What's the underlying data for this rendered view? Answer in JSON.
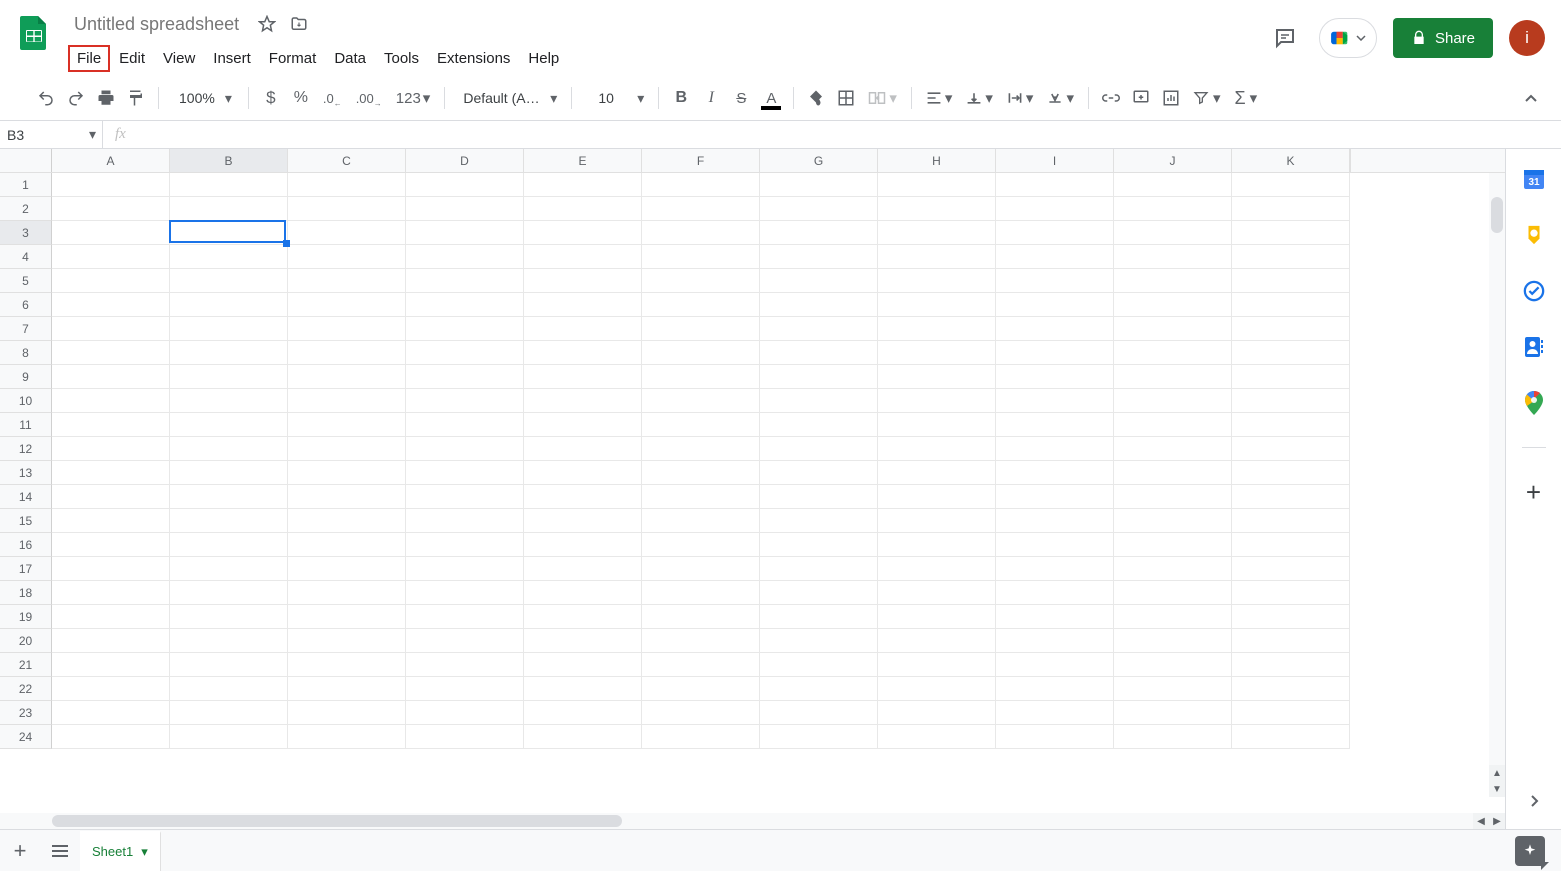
{
  "doc": {
    "title": "Untitled spreadsheet"
  },
  "menubar": {
    "file": "File",
    "edit": "Edit",
    "view": "View",
    "insert": "Insert",
    "format": "Format",
    "data": "Data",
    "tools": "Tools",
    "extensions": "Extensions",
    "help": "Help"
  },
  "highlighted_menu": "file",
  "share": {
    "label": "Share"
  },
  "account": {
    "initial": "i"
  },
  "toolbar": {
    "zoom": "100%",
    "decimal_less": ".0",
    "decimal_more": ".00",
    "numfmt": "123",
    "font": "Default (Ari...",
    "font_size": "10"
  },
  "namebox": {
    "value": "B3"
  },
  "grid": {
    "columns": [
      "A",
      "B",
      "C",
      "D",
      "E",
      "F",
      "G",
      "H",
      "I",
      "J",
      "K"
    ],
    "column_widths": {
      "default": 118
    },
    "row_count": 24,
    "selected_cell": {
      "col": "B",
      "row": 3,
      "col_index": 1,
      "row_index": 2
    }
  },
  "sheets": {
    "active": "Sheet1"
  },
  "sidepanel": {
    "calendar": "31"
  }
}
